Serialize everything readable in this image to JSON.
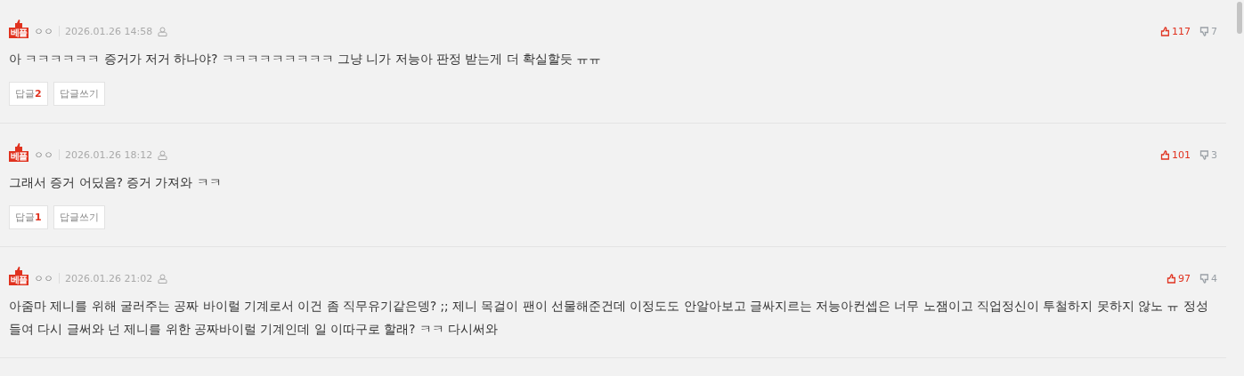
{
  "comments": [
    {
      "badge": "베플",
      "author": "ㅇㅇ",
      "date": "2026.01.26 14:58",
      "likes": "117",
      "dislikes": "7",
      "text": "아 ㅋㅋㅋㅋㅋㅋ 증거가 저거 하나야? ㅋㅋㅋㅋㅋㅋㅋㅋㅋ 그냥 니가 저능아 판정 받는게 더 확실할듯 ㅠㅠ",
      "reply_label": "답글",
      "reply_count": "2",
      "write_label": "답글쓰기"
    },
    {
      "badge": "베플",
      "author": "ㅇㅇ",
      "date": "2026.01.26 18:12",
      "likes": "101",
      "dislikes": "3",
      "text": "그래서 증거 어딨음? 증거 가져와 ㅋㅋ",
      "reply_label": "답글",
      "reply_count": "1",
      "write_label": "답글쓰기"
    },
    {
      "badge": "베플",
      "author": "ㅇㅇ",
      "date": "2026.01.26 21:02",
      "likes": "97",
      "dislikes": "4",
      "text": "아줌마 제니를 위해 굴러주는 공짜 바이럴 기계로서 이건 좀 직무유기같은뎅? ;; 제니 목걸이 팬이 선물해준건데 이정도도 안알아보고 글싸지르는 저능아컨셉은 너무 노잼이고 직업정신이 투철하지 못하지 않노 ㅠ 정성들여 다시 글써와 넌 제니를 위한 공짜바이럴 기계인데 일 이따구로 할래? ㅋㅋ 다시써와"
    }
  ]
}
